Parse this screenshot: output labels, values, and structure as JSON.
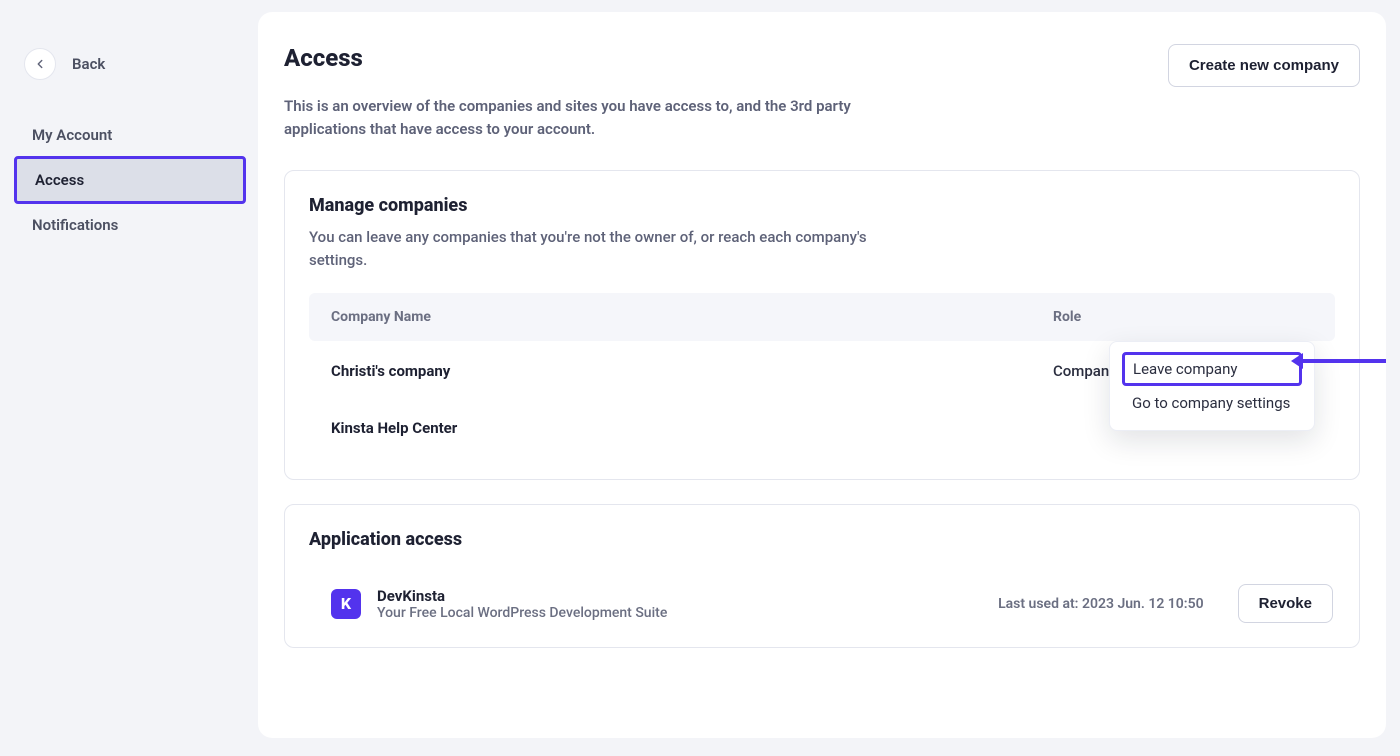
{
  "sidebar": {
    "back_label": "Back",
    "items": [
      {
        "label": "My Account"
      },
      {
        "label": "Access"
      },
      {
        "label": "Notifications"
      }
    ]
  },
  "header": {
    "title": "Access",
    "create_button": "Create new company",
    "description": "This is an overview of the companies and sites you have access to, and the 3rd party applications that have access to your account."
  },
  "companies_card": {
    "title": "Manage companies",
    "description": "You can leave any companies that you're not the owner of, or reach each company's settings.",
    "columns": {
      "name": "Company Name",
      "role": "Role"
    },
    "rows": [
      {
        "name": "Christi's company",
        "role": "Company admin"
      },
      {
        "name": "Kinsta Help Center",
        "role": ""
      }
    ],
    "dropdown": {
      "leave": "Leave company",
      "settings": "Go to company settings"
    }
  },
  "app_card": {
    "title": "Application access",
    "app": {
      "icon_letter": "K",
      "name": "DevKinsta",
      "subtitle": "Your Free Local WordPress Development Suite",
      "last_used_label": "Last used at: 2023 Jun. 12 10:50",
      "revoke": "Revoke"
    }
  }
}
